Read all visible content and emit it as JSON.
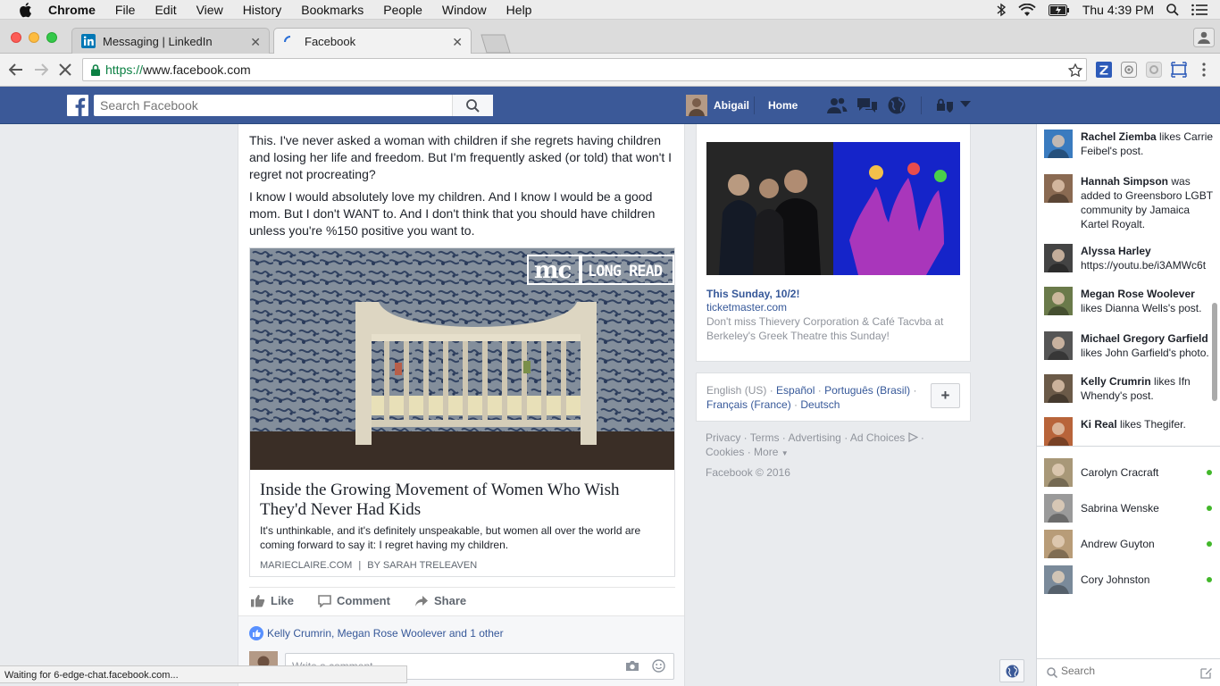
{
  "menubar": {
    "app": "Chrome",
    "items": [
      "File",
      "Edit",
      "View",
      "History",
      "Bookmarks",
      "People",
      "Window",
      "Help"
    ],
    "clock": "Thu 4:39 PM"
  },
  "tabs": [
    {
      "title": "Messaging | LinkedIn"
    },
    {
      "title": "Facebook"
    }
  ],
  "address": {
    "scheme": "https://",
    "host": "www.facebook.com"
  },
  "fb": {
    "search_placeholder": "Search Facebook",
    "profile_name": "Abigail",
    "home": "Home"
  },
  "post": {
    "para1": "This. I've never asked a woman with children if she regrets having children and losing her life and freedom. But I'm frequently asked (or told) that won't I regret not procreating?",
    "para2": "I know I would absolutely love my children. And I know I would be a good mom. But I don't WANT to. And I don't think that you should have children unless you're %150 positive you want to.",
    "badge_logo": "mc",
    "badge_text": "LONG READ",
    "headline": "Inside the Growing Movement of Women Who Wish They'd Never Had Kids",
    "description": "It's unthinkable, and it's definitely unspeakable, but women all over the world are coming forward to say it: I regret having my children.",
    "source": "MARIECLAIRE.COM",
    "byline": "BY SARAH TRELEAVEN",
    "actions": {
      "like": "Like",
      "comment": "Comment",
      "share": "Share"
    },
    "reactions": "Kelly Crumrin, Megan Rose Woolever and 1 other",
    "comment_placeholder": "Write a comment..."
  },
  "ad": {
    "title": "This Sunday, 10/2!",
    "domain": "ticketmaster.com",
    "body": "Don't miss Thievery Corporation & Café Tacvba at Berkeley's Greek Theatre this Sunday!"
  },
  "languages": {
    "current": "English (US)",
    "others": [
      "Español",
      "Português (Brasil)",
      "Français (France)",
      "Deutsch"
    ],
    "add": "+"
  },
  "footer": {
    "links": [
      "Privacy",
      "Terms",
      "Advertising",
      "Ad Choices",
      "Cookies",
      "More"
    ],
    "copyright": "Facebook © 2016"
  },
  "ticker": [
    {
      "name": "Rachel Ziemba",
      "text": " likes Carrie Feibel's post.",
      "color": "#3a7bbf"
    },
    {
      "name": "Hannah Simpson",
      "text": " was added to Greensboro LGBT community by Jamaica Kartel Royalt.",
      "color": "#8a6a52"
    },
    {
      "name": "Alyssa Harley",
      "text": " https://youtu.be/i3AMWc6t",
      "color": "#444444"
    },
    {
      "name": "Megan Rose Woolever",
      "text": " likes Dianna Wells's post.",
      "color": "#6a7a4a"
    },
    {
      "name": "Michael Gregory Garfield",
      "text": " likes John Garfield's photo.",
      "color": "#555555"
    },
    {
      "name": "Kelly Crumrin",
      "text": " likes Ifn Whendy's post.",
      "color": "#6b5a48"
    },
    {
      "name": "Ki Real",
      "text": " likes Thegifer.",
      "color": "#b8643a"
    }
  ],
  "friends": [
    {
      "name": "Carolyn Cracraft",
      "color": "#a89878"
    },
    {
      "name": "Sabrina Wenske",
      "color": "#9a9a9a"
    },
    {
      "name": "Andrew Guyton",
      "color": "#b89c78"
    },
    {
      "name": "Cory Johnston",
      "color": "#7a8a9a"
    }
  ],
  "chat_search_placeholder": "Search",
  "status_bar": "Waiting for 6-edge-chat.facebook.com..."
}
